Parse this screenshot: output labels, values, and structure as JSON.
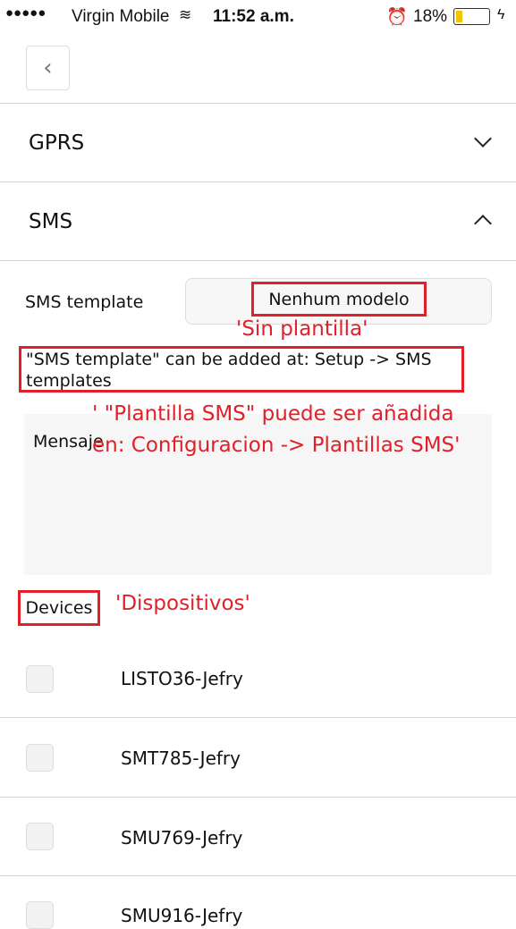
{
  "status_bar": {
    "signal": "●●●●●",
    "carrier": "Virgin Mobile",
    "time": "11:52 a.m.",
    "battery": "18%",
    "battery_level": 0.18,
    "battery_color": "#f5c400"
  },
  "sections": [
    {
      "label": "GPRS",
      "expanded": false
    },
    {
      "label": "SMS",
      "expanded": true
    }
  ],
  "sms": {
    "template_label": "SMS template",
    "template_value": "Nenhum modelo",
    "hint": "\"SMS template\" can be added at: Setup -> SMS templates",
    "message_placeholder": "Mensaje",
    "devices_label": "Devices"
  },
  "annotations": {
    "template": "'Sin plantilla'",
    "hint_line1": "' \"Plantilla SMS\" puede ser añadida",
    "hint_line2": "en: Configuracion -> Plantillas SMS'",
    "devices": "'Dispositivos'",
    "color": "#e0202a"
  },
  "devices": [
    {
      "name": "LISTO36-Jefry"
    },
    {
      "name": "SMT785-Jefry"
    },
    {
      "name": "SMU769-Jefry"
    },
    {
      "name": "SMU916-Jefry"
    }
  ]
}
